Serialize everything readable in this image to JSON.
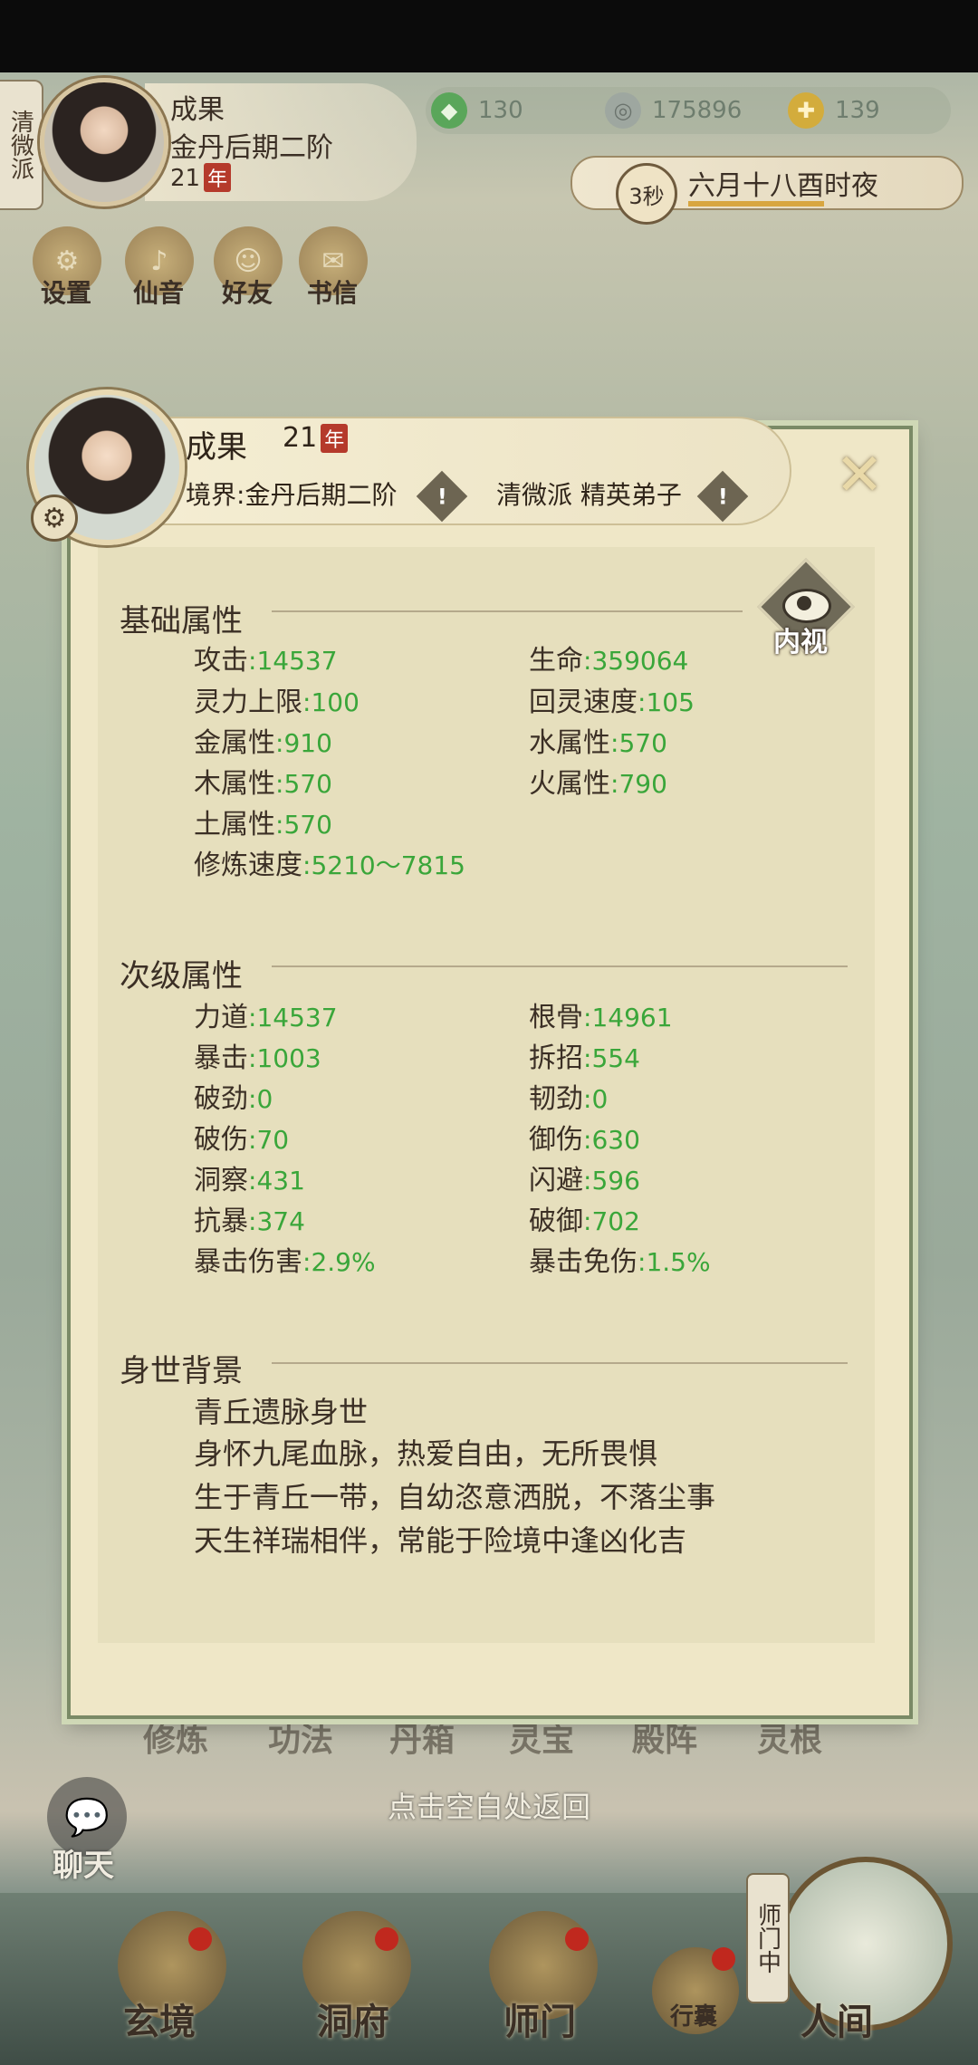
{
  "top": {
    "sect": "清微派",
    "name": "成果",
    "realm": "金丹后期二阶",
    "age": "21",
    "age_unit": "年",
    "res_jade": "130",
    "res_coin": "175896",
    "res_gold": "139",
    "time_badge": "3秒",
    "time_text": "六月十八酉时夜",
    "menu": [
      "设置",
      "仙音",
      "好友",
      "书信"
    ]
  },
  "panel": {
    "name": "成果",
    "age": "21",
    "age_unit": "年",
    "realm_label": "境界:",
    "realm": "金丹后期二阶",
    "sect": "清微派 精英弟子",
    "inner_view": "内视",
    "basic_title": "基础属性",
    "basic": [
      {
        "k": "攻击",
        "v": "14537"
      },
      {
        "k": "生命",
        "v": "359064"
      },
      {
        "k": "灵力上限",
        "v": "100"
      },
      {
        "k": "回灵速度",
        "v": "105"
      },
      {
        "k": "金属性",
        "v": "910"
      },
      {
        "k": "水属性",
        "v": "570"
      },
      {
        "k": "木属性",
        "v": "570"
      },
      {
        "k": "火属性",
        "v": "790"
      },
      {
        "k": "土属性",
        "v": "570"
      },
      {
        "k": "修炼速度",
        "v": "5210～7815"
      }
    ],
    "secondary_title": "次级属性",
    "secondary": [
      {
        "k": "力道",
        "v": "14537"
      },
      {
        "k": "根骨",
        "v": "14961"
      },
      {
        "k": "暴击",
        "v": "1003"
      },
      {
        "k": "拆招",
        "v": "554"
      },
      {
        "k": "破劲",
        "v": "0"
      },
      {
        "k": "韧劲",
        "v": "0"
      },
      {
        "k": "破伤",
        "v": "70"
      },
      {
        "k": "御伤",
        "v": "630"
      },
      {
        "k": "洞察",
        "v": "431"
      },
      {
        "k": "闪避",
        "v": "596"
      },
      {
        "k": "抗暴",
        "v": "374"
      },
      {
        "k": "破御",
        "v": "702"
      },
      {
        "k": "暴击伤害",
        "v": "2.9%"
      },
      {
        "k": "暴击免伤",
        "v": "1.5%"
      }
    ],
    "bio_title": "身世背景",
    "bio": [
      "青丘遗脉身世",
      "身怀九尾血脉，热爱自由，无所畏惧",
      "生于青丘一带，自幼恣意洒脱，不落尘事",
      "天生祥瑞相伴，常能于险境中逢凶化吉"
    ]
  },
  "bottom": {
    "ghost_tabs": [
      "修炼",
      "功法",
      "丹箱",
      "灵宝",
      "殿阵",
      "灵根"
    ],
    "return_tip": "点击空白处返回",
    "chat": "聊天",
    "nav": [
      "玄境",
      "洞府",
      "师门",
      "行囊",
      "人间"
    ],
    "shimen_tag": "师门中"
  }
}
